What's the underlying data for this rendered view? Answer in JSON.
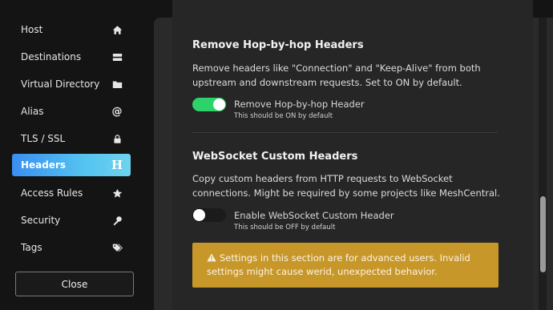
{
  "sidebar": {
    "items": [
      {
        "label": "Host",
        "icon": "home-icon"
      },
      {
        "label": "Destinations",
        "icon": "server-icon"
      },
      {
        "label": "Virtual Directory",
        "icon": "folder-icon"
      },
      {
        "label": "Alias",
        "icon": "at-icon"
      },
      {
        "label": "TLS / SSL",
        "icon": "lock-icon"
      },
      {
        "label": "Headers",
        "icon": "heading-icon",
        "active": true
      },
      {
        "label": "Access Rules",
        "icon": "star-icon"
      },
      {
        "label": "Security",
        "icon": "key-icon"
      },
      {
        "label": "Tags",
        "icon": "tags-icon"
      }
    ],
    "close_label": "Close",
    "active_color": "#3a8ef0"
  },
  "sections": [
    {
      "title": "Remove Hop-by-hop Headers",
      "description": "Remove headers like \"Connection\" and \"Keep-Alive\" from both upstream and downstream requests. Set to ON by default.",
      "toggle_label": "Remove Hop-by-hop Header",
      "toggle_hint": "This should be ON by default",
      "toggle_on": true
    },
    {
      "title": "WebSocket Custom Headers",
      "description": "Copy custom headers from HTTP requests to WebSocket connections. Might be required by some projects like MeshCentral.",
      "toggle_label": "Enable WebSocket Custom Header",
      "toggle_hint": "This should be OFF by default",
      "toggle_on": false
    }
  ],
  "warning": {
    "text": "Settings in this section are for advanced users. Invalid settings might cause werid, unexpected behavior.",
    "icon": "warning-icon"
  },
  "colors": {
    "toggle_on": "#2ed26a",
    "warning_bg": "#c8972a"
  }
}
